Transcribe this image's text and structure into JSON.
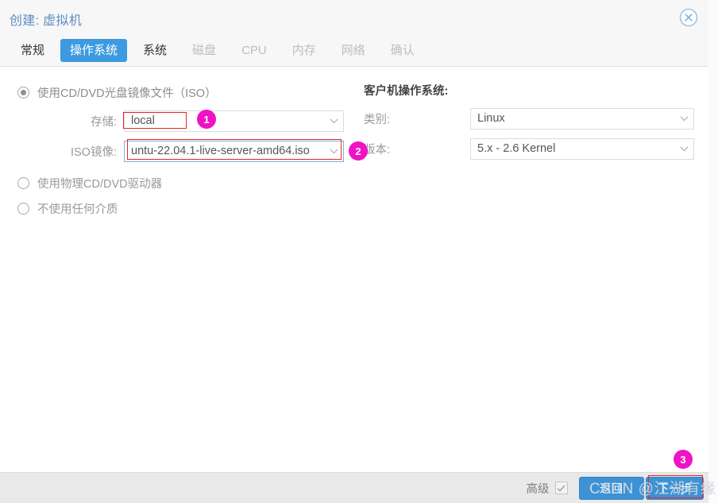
{
  "dialog": {
    "title": "创建: 虚拟机",
    "close_icon": "close-circle-icon"
  },
  "tabs": [
    {
      "label": "常规",
      "state": "enabled"
    },
    {
      "label": "操作系统",
      "state": "active"
    },
    {
      "label": "系统",
      "state": "enabled"
    },
    {
      "label": "磁盘",
      "state": "disabled"
    },
    {
      "label": "CPU",
      "state": "disabled"
    },
    {
      "label": "内存",
      "state": "disabled"
    },
    {
      "label": "网络",
      "state": "disabled"
    },
    {
      "label": "确认",
      "state": "disabled"
    }
  ],
  "media": {
    "options": [
      {
        "label": "使用CD/DVD光盘镜像文件（ISO）",
        "selected": true
      },
      {
        "label": "使用物理CD/DVD驱动器",
        "selected": false
      },
      {
        "label": "不使用任何介质",
        "selected": false
      }
    ],
    "storage": {
      "label": "存储:",
      "value": "local"
    },
    "iso": {
      "label": "ISO镜像:",
      "value": "untu-22.04.1-live-server-amd64.iso"
    }
  },
  "guest_os": {
    "heading": "客户机操作系统:",
    "category": {
      "label": "类别:",
      "value": "Linux"
    },
    "version": {
      "label": "版本:",
      "value": "5.x - 2.6 Kernel"
    }
  },
  "footer": {
    "advanced_label": "高级",
    "advanced_checked": true,
    "back_label": "返回",
    "next_label": "下一步"
  },
  "annotations": {
    "markers": [
      "1",
      "2",
      "3"
    ],
    "highlight_color": "#ee2222",
    "marker_color": "#f012c6"
  },
  "watermark": {
    "brand": "CSDN",
    "author": "@江湖有缘"
  }
}
